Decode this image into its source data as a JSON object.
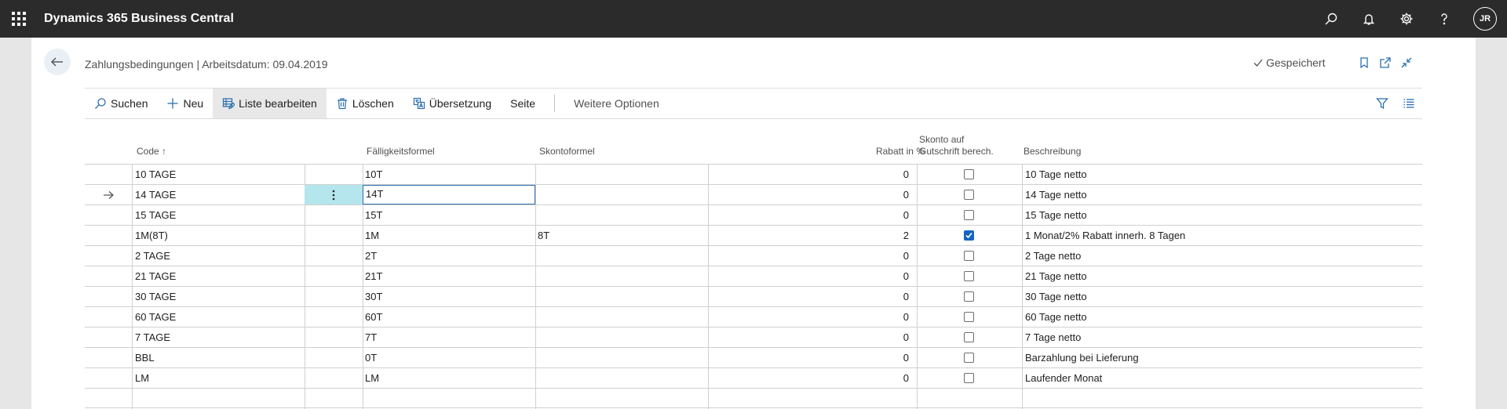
{
  "app": {
    "title": "Dynamics 365 Business Central",
    "avatar_initials": "JR"
  },
  "page": {
    "title": "Zahlungsbedingungen | Arbeitsdatum: 09.04.2019",
    "saved_status": "Gespeichert"
  },
  "actions": {
    "search": "Suchen",
    "new": "Neu",
    "edit_list": "Liste bearbeiten",
    "delete": "Löschen",
    "translation": "Übersetzung",
    "page": "Seite",
    "more_options": "Weitere Optionen"
  },
  "columns": {
    "code": "Code",
    "due_formula": "Fälligkeitsformel",
    "discount_formula": "Skontoformel",
    "discount_pct": "Rabatt in %",
    "credit_discount_1": "Skonto auf",
    "credit_discount_2": "Gutschrift berech.",
    "description": "Beschreibung"
  },
  "rows": [
    {
      "code": "10 TAGE",
      "due": "10T",
      "disc_formula": "",
      "pct": "0",
      "credit": false,
      "desc": "10 Tage netto"
    },
    {
      "code": "14 TAGE",
      "due": "14T",
      "disc_formula": "",
      "pct": "0",
      "credit": false,
      "desc": "14 Tage netto"
    },
    {
      "code": "15 TAGE",
      "due": "15T",
      "disc_formula": "",
      "pct": "0",
      "credit": false,
      "desc": "15 Tage netto"
    },
    {
      "code": "1M(8T)",
      "due": "1M",
      "disc_formula": "8T",
      "pct": "2",
      "credit": true,
      "desc": "1 Monat/2% Rabatt innerh. 8 Tagen"
    },
    {
      "code": "2 TAGE",
      "due": "2T",
      "disc_formula": "",
      "pct": "0",
      "credit": false,
      "desc": "2 Tage netto"
    },
    {
      "code": "21 TAGE",
      "due": "21T",
      "disc_formula": "",
      "pct": "0",
      "credit": false,
      "desc": "21 Tage netto"
    },
    {
      "code": "30 TAGE",
      "due": "30T",
      "disc_formula": "",
      "pct": "0",
      "credit": false,
      "desc": "30 Tage netto"
    },
    {
      "code": "60 TAGE",
      "due": "60T",
      "disc_formula": "",
      "pct": "0",
      "credit": false,
      "desc": "60 Tage netto"
    },
    {
      "code": "7 TAGE",
      "due": "7T",
      "disc_formula": "",
      "pct": "0",
      "credit": false,
      "desc": "7 Tage netto"
    },
    {
      "code": "BBL",
      "due": "0T",
      "disc_formula": "",
      "pct": "0",
      "credit": false,
      "desc": "Barzahlung bei Lieferung"
    },
    {
      "code": "LM",
      "due": "LM",
      "disc_formula": "",
      "pct": "0",
      "credit": false,
      "desc": "Laufender Monat"
    },
    {
      "code": "",
      "due": "",
      "disc_formula": "",
      "pct": "",
      "credit": null,
      "desc": ""
    }
  ],
  "selected_row_index": 1,
  "colors": {
    "appbar": "#2b2b2b",
    "selected_cell": "#b5e5ed",
    "accent": "#1565c0"
  }
}
